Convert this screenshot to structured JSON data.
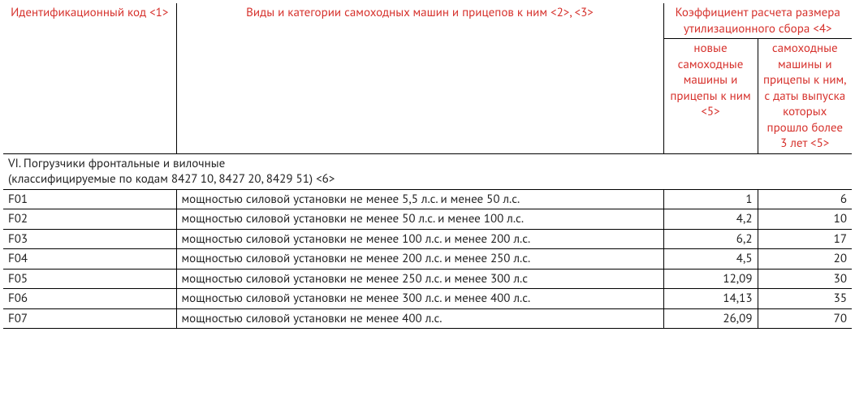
{
  "headers": {
    "col1": "Идентификационный код <1>",
    "col2": "Виды и категории самоходных машин и прицепов к ним <2>, <3>",
    "col34_top": "Коэффициент расчета размера утилизационного сбора <4>",
    "col3": "новые самоходные машины и прицепы к ним <5>",
    "col4": "самоходные машины и прицепы к ним, с даты выпуска которых прошло более 3 лет <5>"
  },
  "section_title": "VI. Погрузчики фронтальные и вилочные\n(классифицируемые по кодам 8427 10, 8427 20, 8429 51) <6>",
  "rows": [
    {
      "code": "F01",
      "desc": "мощностью силовой установки не менее 5,5 л.с. и менее 50 л.с.",
      "new": "1",
      "old": "6"
    },
    {
      "code": "F02",
      "desc": "мощностью силовой установки не менее 50 л.с. и менее 100 л.с.",
      "new": "4,2",
      "old": "10"
    },
    {
      "code": "F03",
      "desc": "мощностью силовой установки не менее 100 л.с. и менее 200 л.с.",
      "new": "6,2",
      "old": "17"
    },
    {
      "code": "F04",
      "desc": "мощностью силовой установки не менее 200 л.с. и менее 250 л.с.",
      "new": "4,5",
      "old": "20"
    },
    {
      "code": "F05",
      "desc": "мощностью силовой установки не менее 250 л.с. и менее 300 л.с",
      "new": "12,09",
      "old": "30"
    },
    {
      "code": "F06",
      "desc": "мощностью силовой установки не менее 300 л.с. и менее 400 л.с.",
      "new": "14,13",
      "old": "35"
    },
    {
      "code": "F07",
      "desc": "мощностью силовой установки не менее 400 л.с.",
      "new": "26,09",
      "old": "70"
    }
  ],
  "chart_data": {
    "type": "table",
    "columns": [
      "Идентификационный код",
      "Виды и категории",
      "Коэффициент (новые)",
      "Коэффициент (>3 лет)"
    ],
    "section": "VI. Погрузчики фронтальные и вилочные (коды 8427 10, 8427 20, 8429 51)",
    "data": [
      [
        "F01",
        "5,5–50 л.с.",
        1,
        6
      ],
      [
        "F02",
        "50–100 л.с.",
        4.2,
        10
      ],
      [
        "F03",
        "100–200 л.с.",
        6.2,
        17
      ],
      [
        "F04",
        "200–250 л.с.",
        4.5,
        20
      ],
      [
        "F05",
        "250–300 л.с.",
        12.09,
        30
      ],
      [
        "F06",
        "300–400 л.с.",
        14.13,
        35
      ],
      [
        "F07",
        "≥400 л.с.",
        26.09,
        70
      ]
    ]
  }
}
